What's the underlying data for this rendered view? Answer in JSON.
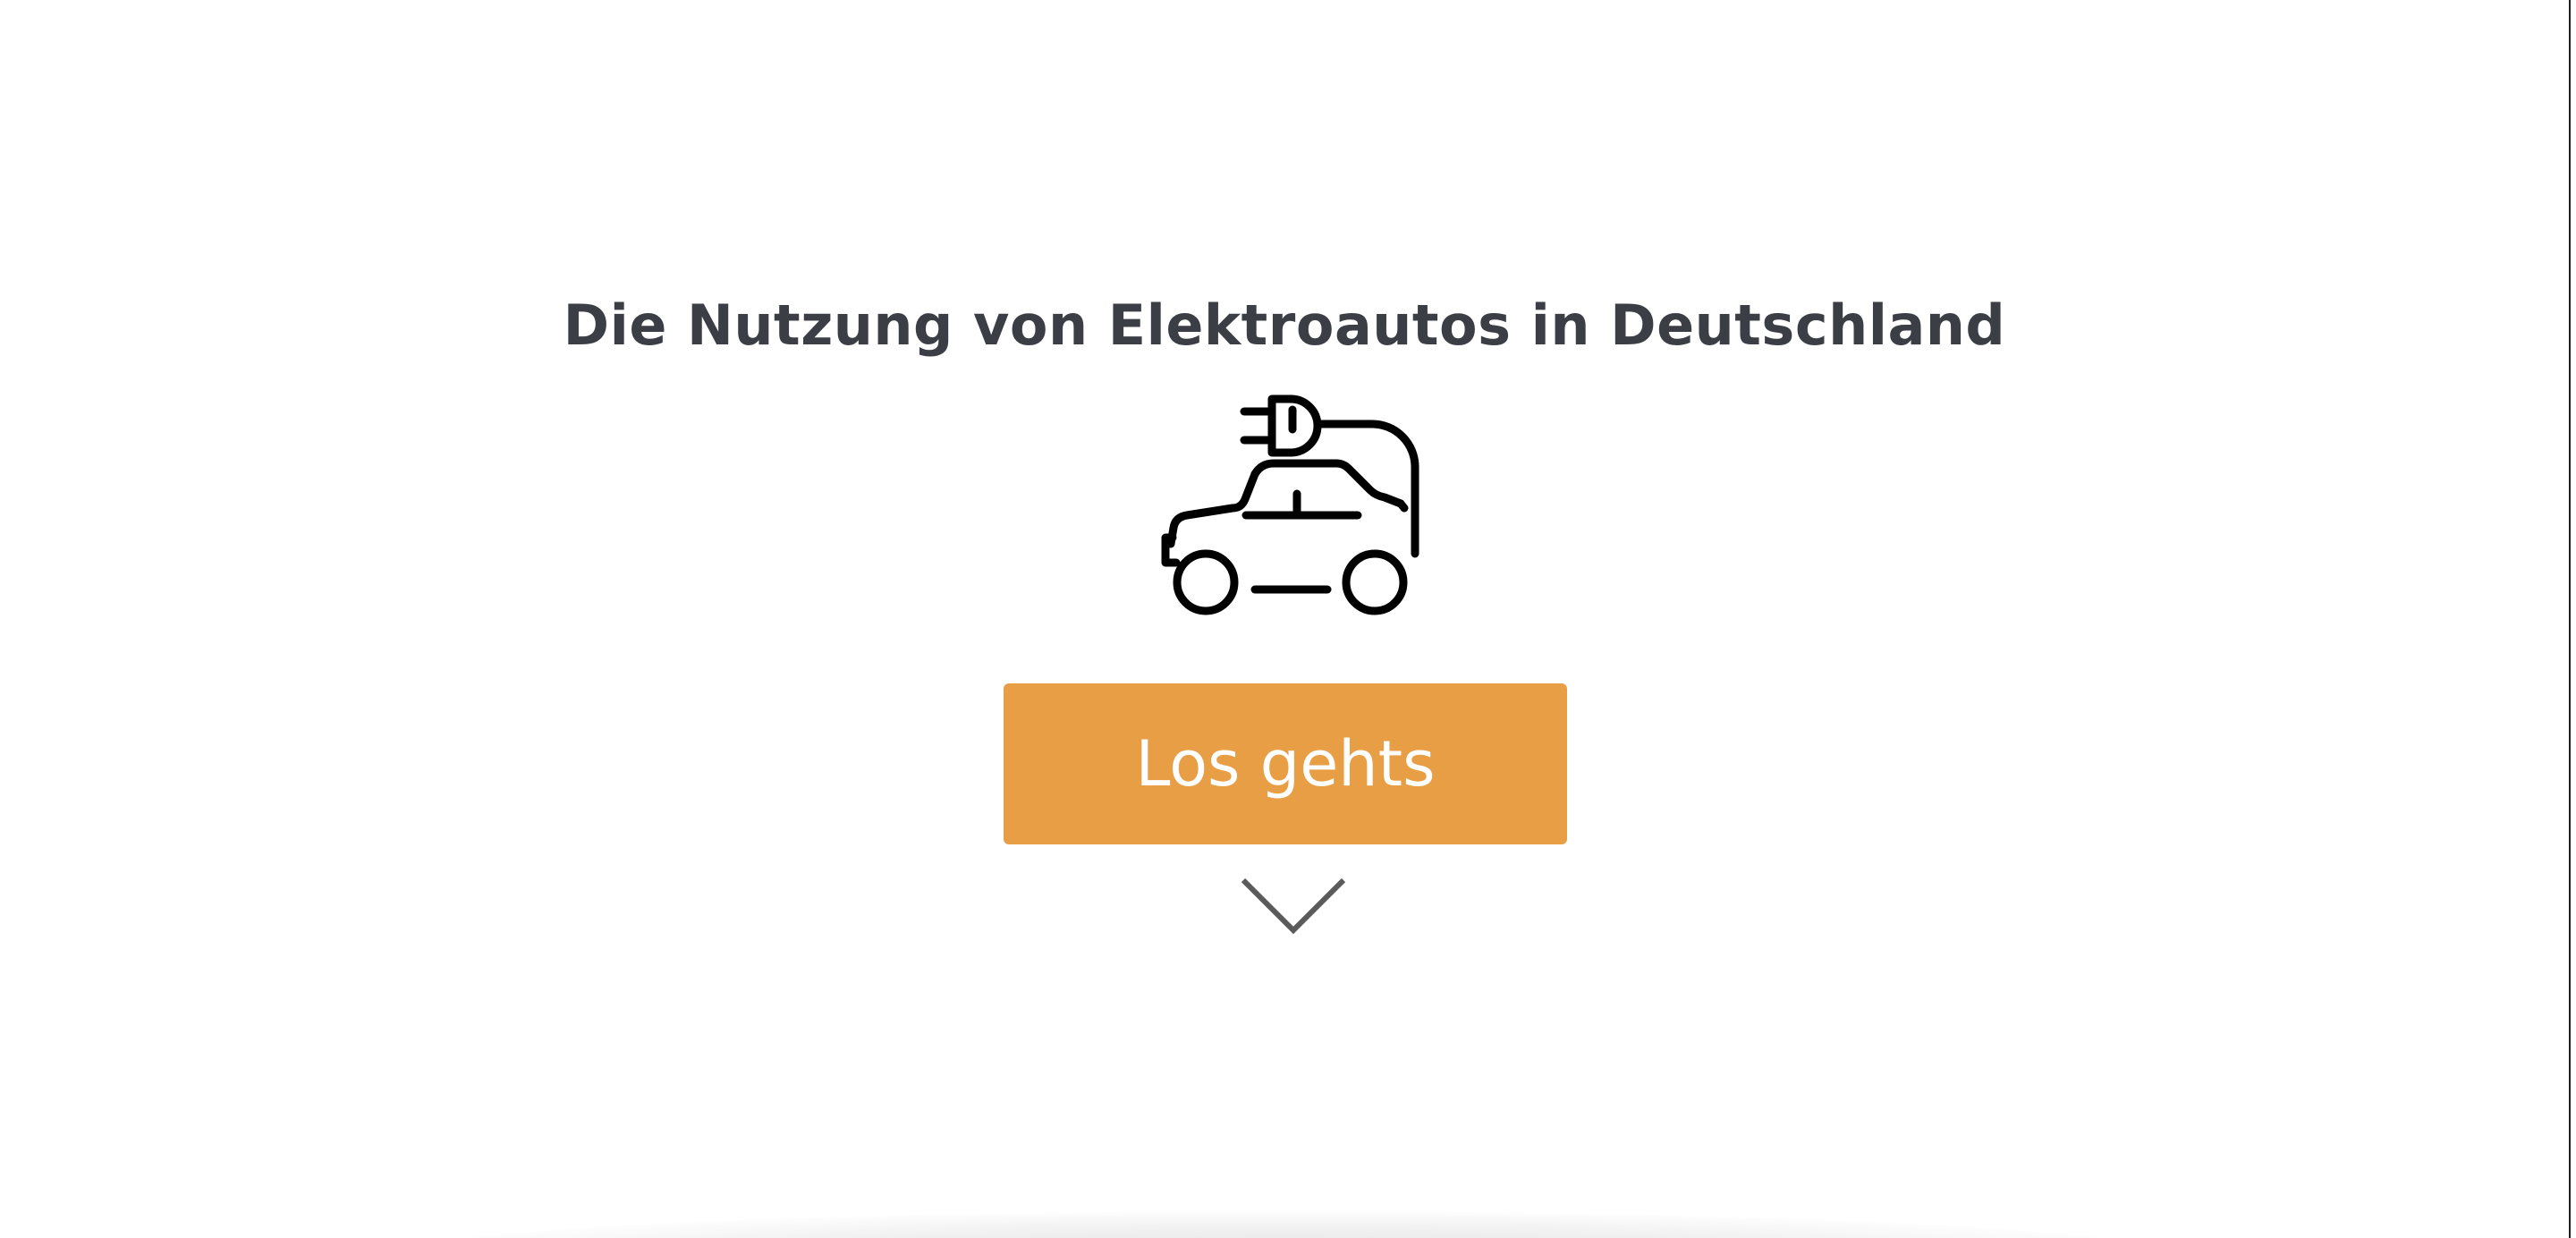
{
  "hero": {
    "title": "Die Nutzung von Elektroautos in Deutschland",
    "icon": "electric-car-plug-icon",
    "start_button_label": "Los gehts",
    "scroll_icon": "chevron-down-icon"
  },
  "colors": {
    "title": "#3b3f45",
    "button_bg": "#e89e44",
    "button_text": "#ffffff",
    "chevron": "#5b5b5b",
    "icon_stroke": "#000000"
  }
}
